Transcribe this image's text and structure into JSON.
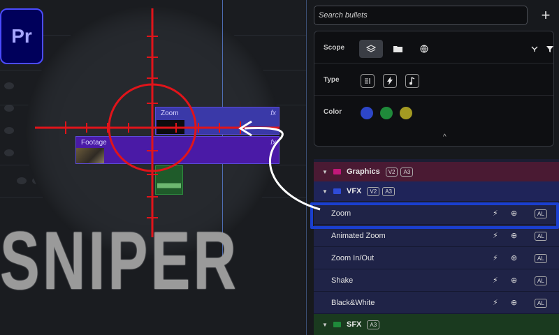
{
  "app_logo": {
    "text": "Pr",
    "icon": "premiere-pro-logo"
  },
  "headline": "SNIPER",
  "timeline": {
    "clips": [
      {
        "label": "Zoom",
        "fx": "fx"
      },
      {
        "label": "Footage",
        "fx": "fx"
      }
    ]
  },
  "panel": {
    "search": {
      "placeholder": "Search bullets"
    },
    "add_button": "+",
    "filters": {
      "scope_label": "Scope",
      "type_label": "Type",
      "color_label": "Color",
      "color_swatches": [
        "#2d46c8",
        "#1f8a3a",
        "#a39a22"
      ],
      "collapse_glyph": "^"
    },
    "groups": [
      {
        "name": "Graphics",
        "badges": [
          "V2",
          "A3"
        ],
        "color": "#c2187a"
      },
      {
        "name": "VFX",
        "badges": [
          "V2",
          "A3"
        ],
        "color": "#2f4bd8"
      },
      {
        "name": "SFX",
        "badges": [
          "A3"
        ],
        "color": "#1f8a3a"
      }
    ],
    "items": [
      {
        "name": "Zoom",
        "tag": "AL"
      },
      {
        "name": "Animated Zoom",
        "tag": "AL"
      },
      {
        "name": "Zoom In/Out",
        "tag": "AL"
      },
      {
        "name": "Shake",
        "tag": "AL"
      },
      {
        "name": "Black&White",
        "tag": "AL"
      }
    ]
  }
}
